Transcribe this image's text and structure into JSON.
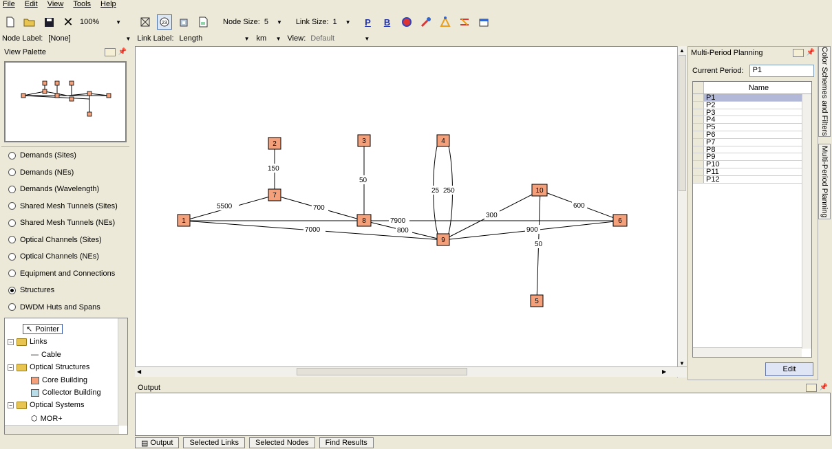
{
  "menu": [
    "File",
    "Edit",
    "View",
    "Tools",
    "Help"
  ],
  "toolbar": {
    "zoom": "100%",
    "node_size_label": "Node Size:",
    "node_size_value": "5",
    "link_size_label": "Link Size:",
    "link_size_value": "1"
  },
  "toolbar2": {
    "node_label_label": "Node Label:",
    "node_label_value": "[None]",
    "link_label_label": "Link Label:",
    "link_label_value": "Length",
    "unit_value": "km",
    "view_label": "View:",
    "view_value": "Default"
  },
  "palette": {
    "title": "View Palette",
    "radios": [
      {
        "label": "Demands (Sites)",
        "selected": false
      },
      {
        "label": "Demands (NEs)",
        "selected": false
      },
      {
        "label": "Demands (Wavelength)",
        "selected": false
      },
      {
        "label": "Shared Mesh Tunnels (Sites)",
        "selected": false
      },
      {
        "label": "Shared Mesh Tunnels (NEs)",
        "selected": false
      },
      {
        "label": "Optical Channels (Sites)",
        "selected": false
      },
      {
        "label": "Optical Channels (NEs)",
        "selected": false
      },
      {
        "label": "Equipment and Connections",
        "selected": false
      },
      {
        "label": "Structures",
        "selected": true
      },
      {
        "label": "DWDM Huts and Spans",
        "selected": false
      }
    ]
  },
  "tree": {
    "pointer": "Pointer",
    "links": "Links",
    "cable": "Cable",
    "optical_structures": "Optical Structures",
    "core_building": "Core Building",
    "collector_building": "Collector Building",
    "optical_systems": "Optical Systems",
    "mor": "MOR+"
  },
  "network": {
    "nodes": [
      "1",
      "2",
      "3",
      "4",
      "5",
      "6",
      "7",
      "8",
      "9",
      "10"
    ],
    "link_labels": [
      "5500",
      "700",
      "150",
      "50",
      "7900",
      "800",
      "7000",
      "25",
      "250",
      "300",
      "600",
      "900",
      "50"
    ]
  },
  "output": {
    "title": "Output",
    "tabs": [
      "Output",
      "Selected Links",
      "Selected Nodes",
      "Find Results"
    ]
  },
  "mpp": {
    "title": "Multi-Period Planning",
    "current_period_label": "Current Period:",
    "current_period_value": "P1",
    "column_header": "Name",
    "periods": [
      "P1",
      "P2",
      "P3",
      "P4",
      "P5",
      "P6",
      "P7",
      "P8",
      "P9",
      "P10",
      "P11",
      "P12"
    ],
    "edit_label": "Edit"
  },
  "side_tabs": [
    "Color Schemes and Filters",
    "Multi-Period Planning"
  ],
  "colors": {
    "node_fill": "#f4a07a",
    "node_border": "#000000",
    "selection": "#b2b8d8",
    "chrome": "#ece9d8"
  }
}
